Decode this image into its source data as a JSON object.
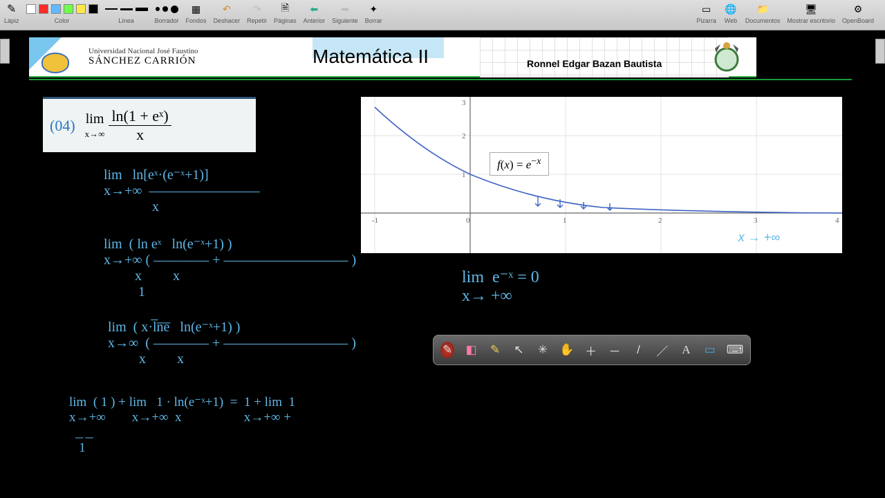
{
  "toolbar": {
    "groups": {
      "lapiz": "Lápiz",
      "color": "Color",
      "linea": "Línea",
      "borrador": "Borrador",
      "fondos": "Fondos",
      "deshacer": "Deshacer",
      "repetir": "Repetir",
      "paginas": "Páginas",
      "anterior": "Anterior",
      "siguiente": "Siguiente",
      "borrar": "Borrar",
      "pizarra": "Pizarra",
      "web": "Web",
      "documentos": "Documentos",
      "mostrar": "Mostrar escritorio",
      "openboard": "OpenBoard"
    },
    "colors": [
      "#ffffff",
      "#ff0000",
      "#64b8ff",
      "#6fff4a",
      "#ffe94a",
      "#000000"
    ]
  },
  "header": {
    "uni_line1": "Universidad Nacional José Faustino",
    "uni_line2": "SÁNCHEZ CARRIÓN",
    "course": "Matemática II",
    "author": "Ronnel Edgar Bazan Bautista"
  },
  "problem": {
    "number": "(04)",
    "lim": "lim",
    "lim_sub": "x→∞",
    "numerator": "ln(1 + eˣ)",
    "denominator": "x"
  },
  "graph": {
    "flabel": "f(x) = e⁻ˣ",
    "note": "x → +∞",
    "xticks": [
      "-1",
      "0",
      "1",
      "2",
      "3",
      "4"
    ],
    "yticks": [
      "1",
      "2",
      "3"
    ]
  },
  "work": {
    "l1": "lim   ln[eˣ·(e⁻ˣ+1)]\nx→+∞  ————————\n              x",
    "l2": "lim  ( ln eˣ   ln(e⁻ˣ+1) )\nx→+∞ ( ———— + ————————— )\n         x         x\n          1",
    "l3": "lim  ( x·l̅n̅e̅   ln(e⁻ˣ+1) )\nx→∞  ( ———— + ————————— )\n         x         x",
    "l4": "lim  ( 1 ) + lim   1 · ln(e⁻ˣ+1)  =  1 + lim  1\nx→+∞        x→+∞  x                   x→+∞ +\n  ͟   ͟\n   1",
    "r1": "lim  e⁻ˣ = 0\nx→ +∞"
  },
  "chart_data": {
    "type": "line",
    "title": "f(x) = e^-x",
    "xlabel": "",
    "ylabel": "",
    "xlim": [
      -1,
      4
    ],
    "ylim": [
      0,
      3
    ],
    "x": [
      -1,
      -0.5,
      0,
      0.5,
      1,
      1.5,
      2,
      2.5,
      3,
      3.5,
      4
    ],
    "values": [
      2.718,
      1.649,
      1.0,
      0.607,
      0.368,
      0.223,
      0.135,
      0.082,
      0.05,
      0.03,
      0.018
    ]
  }
}
